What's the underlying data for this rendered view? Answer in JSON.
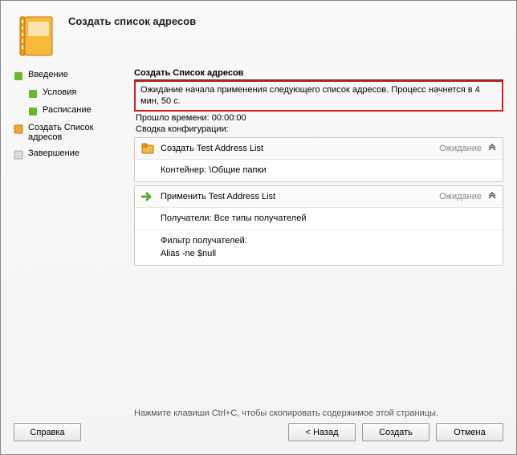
{
  "header": {
    "title": "Создать список адресов"
  },
  "sidebar": {
    "steps": [
      {
        "label": "Введение"
      },
      {
        "label": "Условия"
      },
      {
        "label": "Расписание"
      },
      {
        "label": "Создать Список адресов"
      },
      {
        "label": "Завершение"
      }
    ]
  },
  "main": {
    "heading": "Создать Список адресов",
    "notice": "Ожидание начала применения следующего список адресов. Процесс начнется в 4 мин, 50 с.",
    "elapsed_label": "Прошло времени:",
    "elapsed_value": "00:00:00",
    "summary_label": "Сводка конфигурации:",
    "group1": {
      "title": "Создать Test Address List",
      "status": "Ожидание",
      "container_line": "Контейнер: \\Общие папки"
    },
    "group2": {
      "title": "Применить Test Address List",
      "status": "Ожидание",
      "recipients_line": "Получатели: Все типы получателей",
      "filter_label": "Фильтр получателей:",
      "filter_value": "Alias -ne $null"
    }
  },
  "footer": {
    "help_text": "Нажмите клавиши Ctrl+C, чтобы скопировать содержимое этой страницы.",
    "buttons": {
      "help": "Справка",
      "back": "< Назад",
      "create": "Создать",
      "cancel": "Отмена"
    }
  }
}
